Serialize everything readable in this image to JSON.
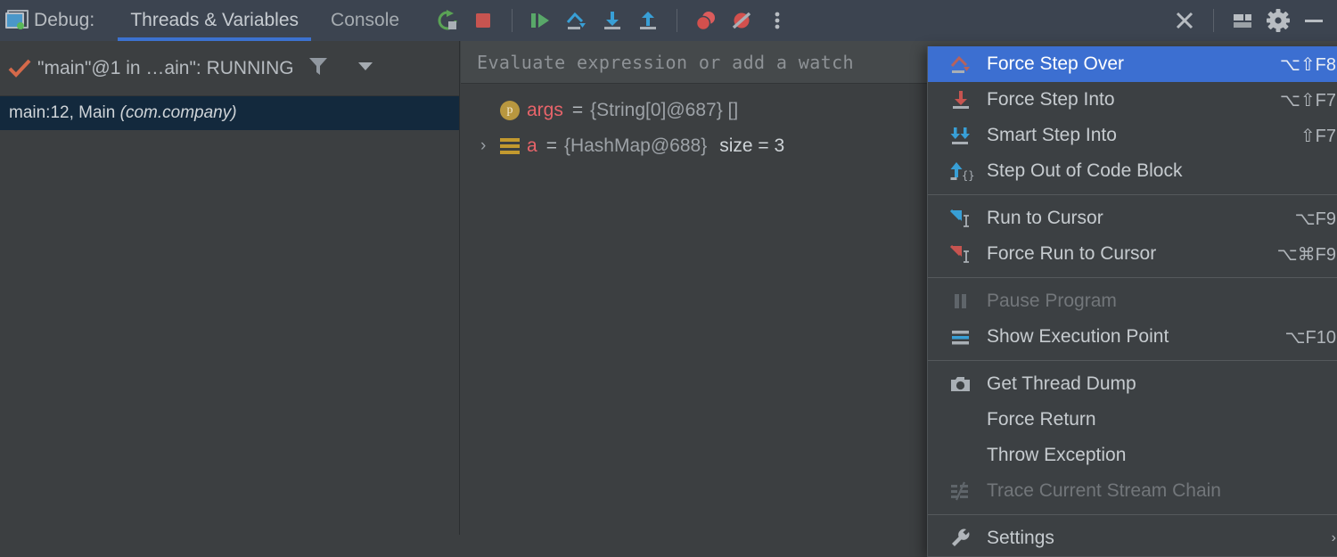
{
  "window": {
    "title": "Debug:",
    "app_icon": "debugger-window-icon"
  },
  "tabs": [
    {
      "label": "Threads & Variables",
      "active": true
    },
    {
      "label": "Console",
      "active": false
    }
  ],
  "toolbar": {
    "buttons": [
      {
        "name": "rerun-button",
        "icon": "rerun-icon",
        "color": "#5aa355"
      },
      {
        "name": "stop-button",
        "icon": "stop-square-icon",
        "color": "#c75450"
      },
      {
        "name": "resume-program-button",
        "icon": "resume-icon",
        "color": "#59a869"
      },
      {
        "name": "step-over-button",
        "icon": "step-over-icon",
        "color": "#389fd6"
      },
      {
        "name": "step-into-button",
        "icon": "step-into-icon",
        "color": "#389fd6"
      },
      {
        "name": "step-out-button",
        "icon": "step-out-icon",
        "color": "#389fd6"
      },
      {
        "name": "view-breakpoints-button",
        "icon": "breakpoints-icon",
        "color": "#db5c5c"
      },
      {
        "name": "mute-breakpoints-button",
        "icon": "mute-breakpoints-icon",
        "color": "#db5c5c"
      },
      {
        "name": "more-options-button",
        "icon": "vertical-ellipsis-icon",
        "color": "#b8bdc2"
      }
    ],
    "window_controls": [
      {
        "name": "close-button",
        "icon": "close-x-icon"
      },
      {
        "name": "layout-settings-button",
        "icon": "layout-icon"
      },
      {
        "name": "settings-button",
        "icon": "gear-icon"
      },
      {
        "name": "minimize-button",
        "icon": "minimize-icon"
      }
    ]
  },
  "threads": {
    "status_icon": "running-check-icon",
    "selected_thread": "\"main\"@1 in …ain\": RUNNING",
    "filter_icon": "filter-funnel-icon",
    "dropdown_icon": "chevron-down-icon",
    "frames": [
      {
        "label": "main:12, Main",
        "package": "(com.company)",
        "selected": true
      }
    ]
  },
  "variables": {
    "evaluate": {
      "placeholder": "Evaluate expression or add a watch",
      "value": ""
    },
    "rows": [
      {
        "icon": "parameter-icon",
        "expandable": false,
        "name": "args",
        "equals": "=",
        "value": "{String[0]@687} []",
        "extra": ""
      },
      {
        "icon": "hashmap-icon",
        "expandable": true,
        "name": "a",
        "equals": "=",
        "value": "{HashMap@688}",
        "extra": "size = 3"
      }
    ]
  },
  "menu": {
    "accent": "#3c6fd1",
    "items": [
      {
        "label": "Force Step Over",
        "shortcut": "⌥⇧F8",
        "icon": "force-step-over-icon",
        "selected": true,
        "disabled": false,
        "separator_before": false,
        "submenu": false
      },
      {
        "label": "Force Step Into",
        "shortcut": "⌥⇧F7",
        "icon": "force-step-into-icon",
        "selected": false,
        "disabled": false,
        "separator_before": false,
        "submenu": false
      },
      {
        "label": "Smart Step Into",
        "shortcut": "⇧F7",
        "icon": "smart-step-into-icon",
        "selected": false,
        "disabled": false,
        "separator_before": false,
        "submenu": false
      },
      {
        "label": "Step Out of Code Block",
        "shortcut": "",
        "icon": "step-out-of-code-block-icon",
        "selected": false,
        "disabled": false,
        "separator_before": false,
        "submenu": false
      },
      {
        "label": "Run to Cursor",
        "shortcut": "⌥F9",
        "icon": "run-to-cursor-icon",
        "selected": false,
        "disabled": false,
        "separator_before": true,
        "submenu": false
      },
      {
        "label": "Force Run to Cursor",
        "shortcut": "⌥⌘F9",
        "icon": "force-run-to-cursor-icon",
        "selected": false,
        "disabled": false,
        "separator_before": false,
        "submenu": false
      },
      {
        "label": "Pause Program",
        "shortcut": "",
        "icon": "pause-icon",
        "selected": false,
        "disabled": true,
        "separator_before": true,
        "submenu": false
      },
      {
        "label": "Show Execution Point",
        "shortcut": "⌥F10",
        "icon": "show-execution-point-icon",
        "selected": false,
        "disabled": false,
        "separator_before": false,
        "submenu": false
      },
      {
        "label": "Get Thread Dump",
        "shortcut": "",
        "icon": "camera-icon",
        "selected": false,
        "disabled": false,
        "separator_before": true,
        "submenu": false
      },
      {
        "label": "Force Return",
        "shortcut": "",
        "icon": "",
        "selected": false,
        "disabled": false,
        "separator_before": false,
        "submenu": false
      },
      {
        "label": "Throw Exception",
        "shortcut": "",
        "icon": "",
        "selected": false,
        "disabled": false,
        "separator_before": false,
        "submenu": false
      },
      {
        "label": "Trace Current Stream Chain",
        "shortcut": "",
        "icon": "trace-stream-chain-icon",
        "selected": false,
        "disabled": true,
        "separator_before": false,
        "submenu": false
      },
      {
        "label": "Settings",
        "shortcut": "",
        "icon": "wrench-icon",
        "selected": false,
        "disabled": false,
        "separator_before": true,
        "submenu": true
      }
    ],
    "submenu_arrow": "›"
  }
}
